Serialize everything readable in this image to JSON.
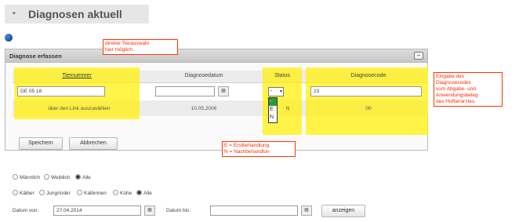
{
  "header": {
    "title": "Diagnosen aktuell",
    "bullet": "▪"
  },
  "panel": {
    "title": "Diagnose erfassen",
    "minimize": "−",
    "columns": [
      "Tiernummer",
      "Diagnosedatum",
      "Status",
      "Diagnosecode"
    ],
    "row_input": {
      "tiernummer": "DE 05 18",
      "diagnosedatum": "",
      "status": "-",
      "diagnosecode": "23"
    },
    "row_info": {
      "tiernummer": "über den Link auszuwählen",
      "diagnosedatum": "10.05.2006",
      "status": "N",
      "diagnosecode": "00"
    },
    "status_options": [
      "-",
      "E",
      "N"
    ],
    "buttons": {
      "save": "Speichern",
      "cancel": "Abbrechen"
    }
  },
  "notes": {
    "tierauswahl": "direkte Tierauswahl\nhier möglich.",
    "status": "E = Erstbehandlung\nN = Nachbehandlun",
    "diagnosecode": "Eingabe des\nDiagnosecodes\nvom Abgabe- und\nAnwendungsbeleg\ndes Hoftierarztes."
  },
  "filters": {
    "sex": [
      {
        "label": "Männlich",
        "selected": false
      },
      {
        "label": "Weiblich",
        "selected": false
      },
      {
        "label": "Alle",
        "selected": true
      }
    ],
    "category": [
      {
        "label": "Kälber",
        "selected": false
      },
      {
        "label": "Jungrinder",
        "selected": false
      },
      {
        "label": "Kalbinnen",
        "selected": false
      },
      {
        "label": "Kühe",
        "selected": false
      },
      {
        "label": "Alle",
        "selected": true
      }
    ],
    "date_from_label": "Datum von:",
    "date_from_value": "27.04.2014",
    "date_to_label": "Datum bis:",
    "date_to_value": "",
    "show_button": "anzeigen"
  },
  "colors": {
    "highlight": "#fff000",
    "note_red": "#ff2a00",
    "status_green": "#2e9a3a",
    "info_blue": "#3a78c8"
  }
}
